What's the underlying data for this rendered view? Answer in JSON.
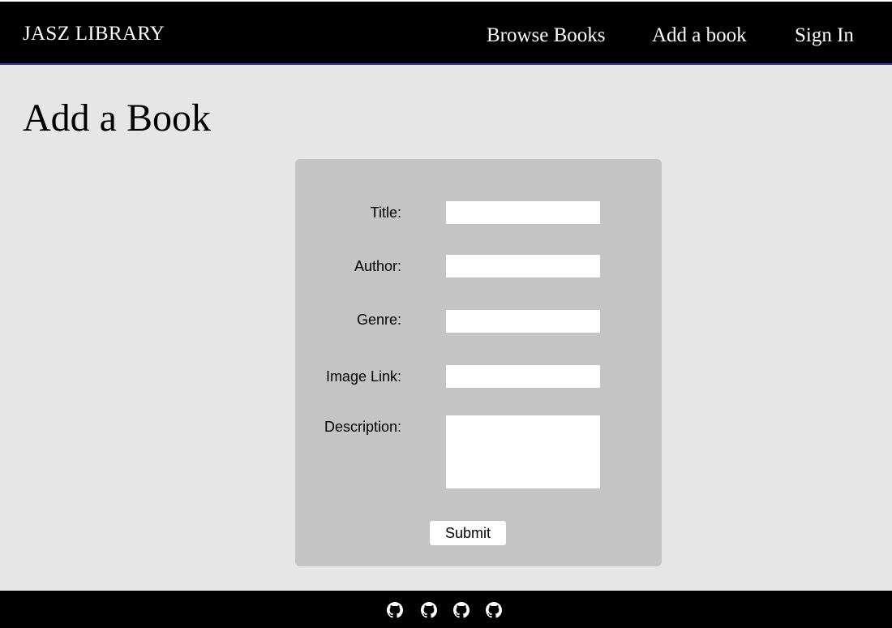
{
  "header": {
    "brand": "JASZ LIBRARY",
    "nav": [
      {
        "label": "Browse Books"
      },
      {
        "label": "Add a book"
      },
      {
        "label": "Sign In"
      }
    ]
  },
  "page": {
    "title": "Add a Book"
  },
  "form": {
    "fields": [
      {
        "label": "Title:",
        "value": ""
      },
      {
        "label": "Author:",
        "value": ""
      },
      {
        "label": "Genre:",
        "value": ""
      },
      {
        "label": "Image Link:",
        "value": ""
      },
      {
        "label": "Description:",
        "value": ""
      }
    ],
    "submit_label": "Submit"
  },
  "footer": {
    "icons": [
      "github-icon",
      "github-icon",
      "github-icon",
      "github-icon"
    ]
  },
  "colors": {
    "header_bg": "#000000",
    "header_accent_border": "#3a3aa8",
    "page_bg": "#e6e6e6",
    "card_bg": "#c4c4c4",
    "footer_bg": "#000000"
  }
}
